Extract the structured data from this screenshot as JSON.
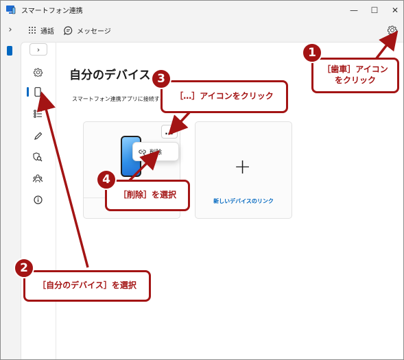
{
  "window": {
    "title": "スマートフォン連携",
    "controls": {
      "minimize": "—",
      "maximize": "☐",
      "close": "✕"
    }
  },
  "topnav": {
    "expand_icon": "chevron-right-icon",
    "tabs": [
      {
        "label": "通話",
        "icon": "dialpad-icon"
      },
      {
        "label": "メッセージ",
        "icon": "chat-icon"
      }
    ],
    "settings_icon": "gear-icon"
  },
  "side_rail": {
    "items": [
      {
        "name": "settings",
        "icon": "gear-icon"
      },
      {
        "name": "my-devices",
        "icon": "phone-icon",
        "active": true
      },
      {
        "name": "features",
        "icon": "list-icon"
      },
      {
        "name": "personalize",
        "icon": "pen-icon"
      },
      {
        "name": "privacy",
        "icon": "search-shield-icon"
      },
      {
        "name": "feedback",
        "icon": "people-icon"
      },
      {
        "name": "about",
        "icon": "info-icon"
      }
    ]
  },
  "main": {
    "title": "自分のデバイス",
    "description": "スマートフォン連携アプリに接続する",
    "device_card": {
      "more_label": "…",
      "menu_item": "削除"
    },
    "link_card": {
      "plus": "+",
      "label": "新しいデバイスのリンク"
    }
  },
  "annotations": [
    {
      "number": "1",
      "text_line1": "［歯車］アイコン",
      "text_line2": "をクリック"
    },
    {
      "number": "2",
      "text": "［自分のデバイス］を選択"
    },
    {
      "number": "3",
      "text": "［…］アイコンをクリック"
    },
    {
      "number": "4",
      "text": "［削除］を選択"
    }
  ],
  "colors": {
    "accent": "#0067c0",
    "annotation": "#a31414"
  }
}
